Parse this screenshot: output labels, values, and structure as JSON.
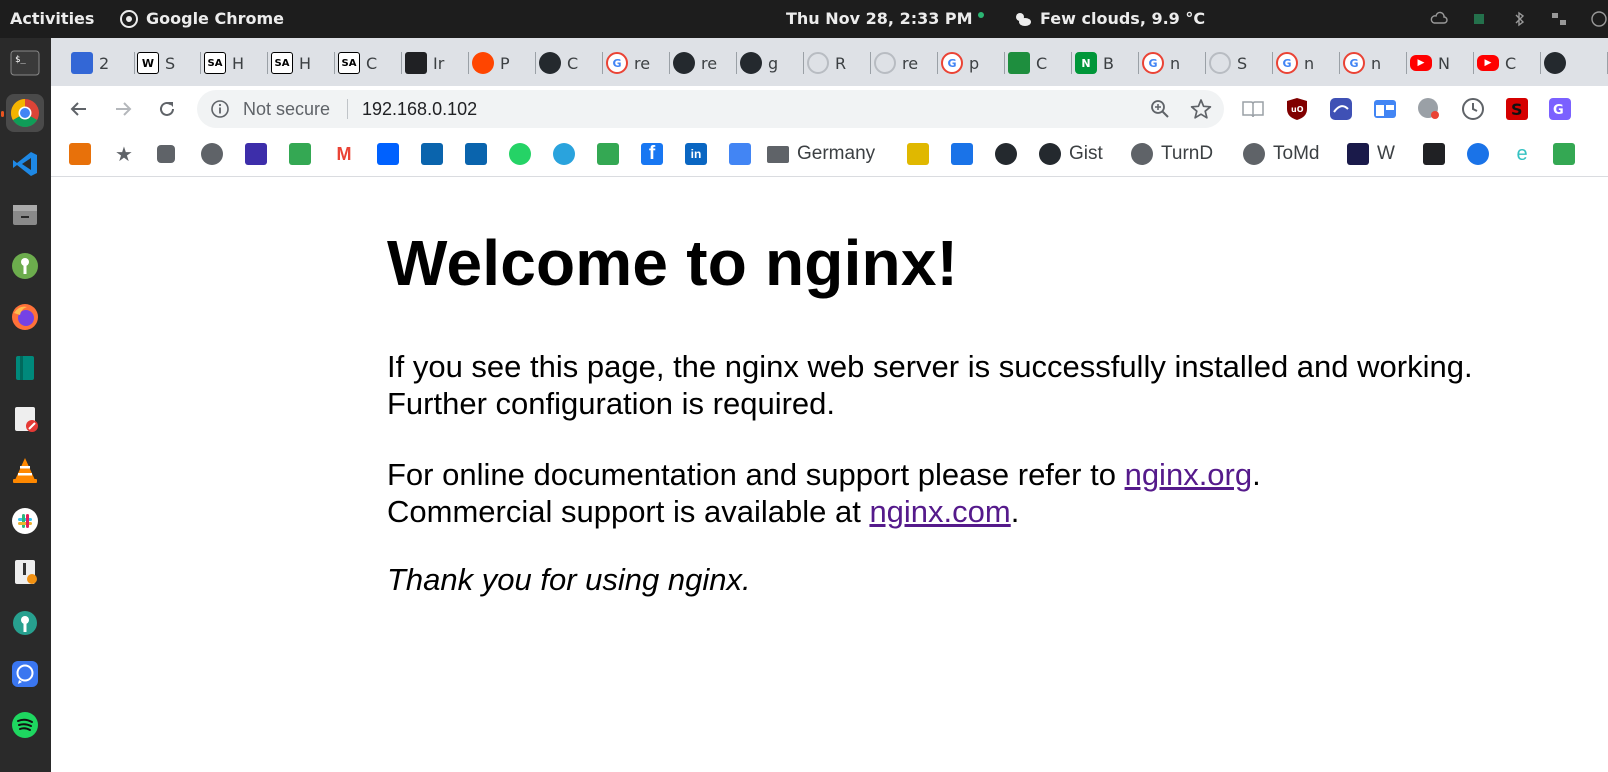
{
  "topbar": {
    "activities": "Activities",
    "app_name": "Google Chrome",
    "clock": "Thu Nov 28,  2:33 PM",
    "weather": "Few clouds, 9.9 °C"
  },
  "dock": {
    "items": [
      "terminal-icon",
      "chrome-icon",
      "vscode-icon",
      "files-icon",
      "keepassxc-icon",
      "firefox-icon",
      "book-reader-icon",
      "text-editor-icon",
      "vlc-icon",
      "slack-icon",
      "installer-icon",
      "settings-wrench-icon",
      "signal-icon",
      "spotify-icon"
    ]
  },
  "tabs": [
    {
      "icon": "calendar-icon",
      "label": "2",
      "color": "#3367d6"
    },
    {
      "icon": "wikipedia-icon",
      "label": "S",
      "color": "#ffffff"
    },
    {
      "icon": "seeking-alpha-icon",
      "label": "H",
      "color": "#ffffff"
    },
    {
      "icon": "seeking-alpha-icon",
      "label": "H",
      "color": "#ffffff"
    },
    {
      "icon": "seeking-alpha-icon",
      "label": "C",
      "color": "#ffffff"
    },
    {
      "icon": "graduation-cap-icon",
      "label": "Ir",
      "color": "#202124"
    },
    {
      "icon": "reddit-icon",
      "label": "P",
      "color": "#ff4500"
    },
    {
      "icon": "github-icon",
      "label": "C",
      "color": "#24292e"
    },
    {
      "icon": "google-icon",
      "label": "re",
      "color": "#4285f4"
    },
    {
      "icon": "github-icon",
      "label": "re",
      "color": "#24292e"
    },
    {
      "icon": "github-icon",
      "label": "g",
      "color": "#24292e"
    },
    {
      "icon": "loading-icon",
      "label": "R",
      "color": "#9aa0a6"
    },
    {
      "icon": "loading-icon",
      "label": "re",
      "color": "#9aa0a6"
    },
    {
      "icon": "google-icon",
      "label": "p",
      "color": "#4285f4"
    },
    {
      "icon": "leaf-icon",
      "label": "C",
      "color": "#1e8e3e"
    },
    {
      "icon": "nginx-icon",
      "label": "B",
      "color": "#009639"
    },
    {
      "icon": "google-icon",
      "label": "n",
      "color": "#4285f4"
    },
    {
      "icon": "loading-icon",
      "label": "S",
      "color": "#9aa0a6"
    },
    {
      "icon": "google-icon",
      "label": "n",
      "color": "#4285f4"
    },
    {
      "icon": "google-icon",
      "label": "n",
      "color": "#4285f4"
    },
    {
      "icon": "youtube-icon",
      "label": "N",
      "color": "#ff0000"
    },
    {
      "icon": "youtube-icon",
      "label": "C",
      "color": "#ff0000"
    },
    {
      "icon": "github-icon",
      "label": "",
      "color": "#24292e"
    }
  ],
  "omnibox": {
    "security_label": "Not secure",
    "url": "192.168.0.102"
  },
  "bookmarks": [
    {
      "icon": "chrome-web-store-icon",
      "label": "",
      "color": "#e8710a"
    },
    {
      "icon": "star-icon",
      "label": "",
      "color": "#5f6368"
    },
    {
      "icon": "puzzle-icon",
      "label": "",
      "color": "#5f6368"
    },
    {
      "icon": "globe-icon",
      "label": "",
      "color": "#5f6368"
    },
    {
      "icon": "calendar-icon",
      "label": "",
      "color": "#3d2eaa"
    },
    {
      "icon": "maps-icon",
      "label": "",
      "color": "#34a853"
    },
    {
      "icon": "gmail-icon",
      "label": "",
      "color": "#ea4335"
    },
    {
      "icon": "dropbox-icon",
      "label": "",
      "color": "#0061fe"
    },
    {
      "icon": "outlook-icon",
      "label": "",
      "color": "#0a64ad"
    },
    {
      "icon": "outlook-icon",
      "label": "",
      "color": "#0a64ad"
    },
    {
      "icon": "whatsapp-icon",
      "label": "",
      "color": "#25d366"
    },
    {
      "icon": "telegram-icon",
      "label": "",
      "color": "#2aa3dd"
    },
    {
      "icon": "maps-icon",
      "label": "",
      "color": "#34a853"
    },
    {
      "icon": "facebook-icon",
      "label": "",
      "color": "#1877f2"
    },
    {
      "icon": "linkedin-icon",
      "label": "",
      "color": "#0a66c2"
    },
    {
      "icon": "translate-icon",
      "label": "",
      "color": "#4285f4"
    },
    {
      "icon": "folder-icon",
      "label": "Germany",
      "color": "#5f6368"
    },
    {
      "icon": "hedgehog-icon",
      "label": "",
      "color": "#e0b800"
    },
    {
      "icon": "wiki-icon",
      "label": "",
      "color": "#1a73e8"
    },
    {
      "icon": "github-icon",
      "label": "",
      "color": "#24292e"
    },
    {
      "icon": "github-icon",
      "label": "Gist",
      "color": "#24292e"
    },
    {
      "icon": "globe-icon",
      "label": "TurnD",
      "color": "#5f6368"
    },
    {
      "icon": "globe-icon",
      "label": "ToMd",
      "color": "#5f6368"
    },
    {
      "icon": "brain-icon",
      "label": "W",
      "color": "#1a1a4a"
    },
    {
      "icon": "qr-icon",
      "label": "",
      "color": "#202124"
    },
    {
      "icon": "edge-icon",
      "label": "",
      "color": "#1a73e8"
    },
    {
      "icon": "e-icon",
      "label": "",
      "color": "#35c2c2"
    },
    {
      "icon": "check-icon",
      "label": "",
      "color": "#34a853"
    }
  ],
  "content": {
    "heading": "Welcome to nginx!",
    "para1_line1": "If you see this page, the nginx web server is successfully installed and working.",
    "para1_line2": "Further configuration is required.",
    "para2_prefix": "For online documentation and support please refer to ",
    "link_org": "nginx.org",
    "para2_suffix": ".",
    "para3_prefix": "Commercial support is available at ",
    "link_com": "nginx.com",
    "para3_suffix": ".",
    "thanks": "Thank you for using nginx."
  }
}
